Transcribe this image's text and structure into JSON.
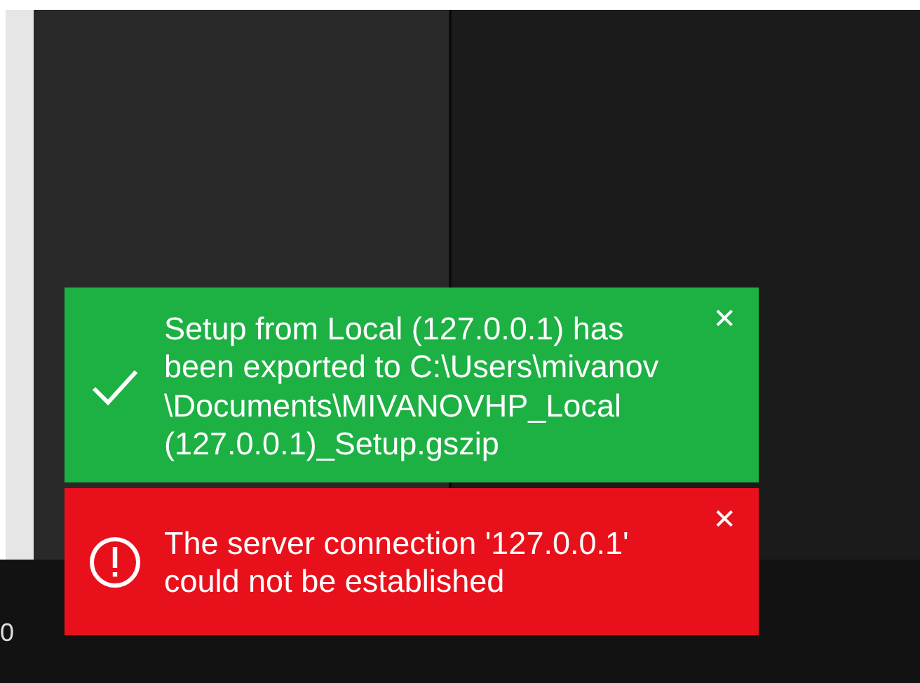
{
  "background": {
    "corner_text": "0"
  },
  "toasts": [
    {
      "kind": "success",
      "message": "Setup from Local (127.0.0.1) has\nbeen exported to C:\\Users\\mivanov\n\\Documents\\MIVANOVHP_Local\n(127.0.0.1)_Setup.gszip",
      "close": "✕"
    },
    {
      "kind": "error",
      "message": "The server connection '127.0.0.1'\ncould not be established",
      "close": "✕"
    }
  ]
}
